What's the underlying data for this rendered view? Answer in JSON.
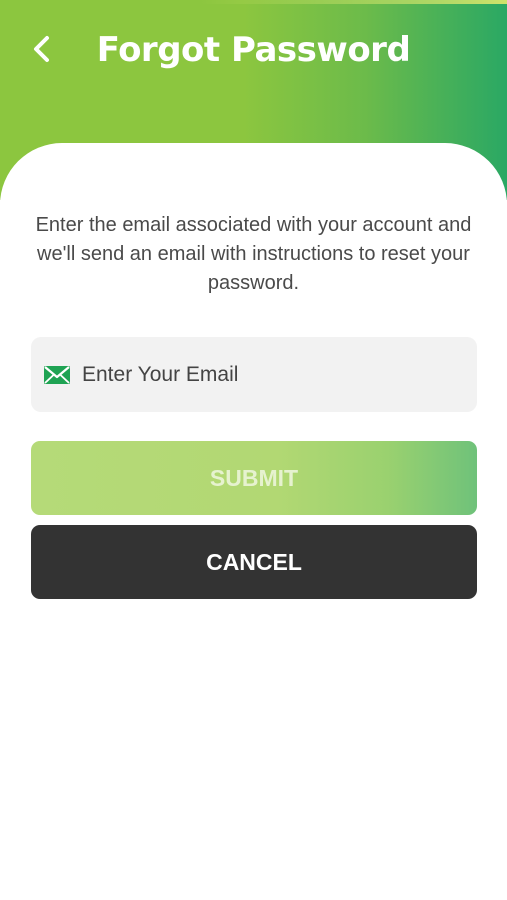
{
  "header": {
    "title": "Forgot Password",
    "back_icon": "chevron-left-icon"
  },
  "form": {
    "description": "Enter the email associated with your account and we'll send an email with instructions to reset your password.",
    "email": {
      "placeholder": "Enter Your Email",
      "value": "",
      "icon": "envelope-icon"
    },
    "submit_label": "SUBMIT",
    "cancel_label": "CANCEL"
  },
  "colors": {
    "accent_green": "#8cc63f",
    "accent_teal": "#2aa864",
    "envelope_green": "#1fa353",
    "cancel_bg": "#333333",
    "field_bg": "#f2f2f2"
  }
}
